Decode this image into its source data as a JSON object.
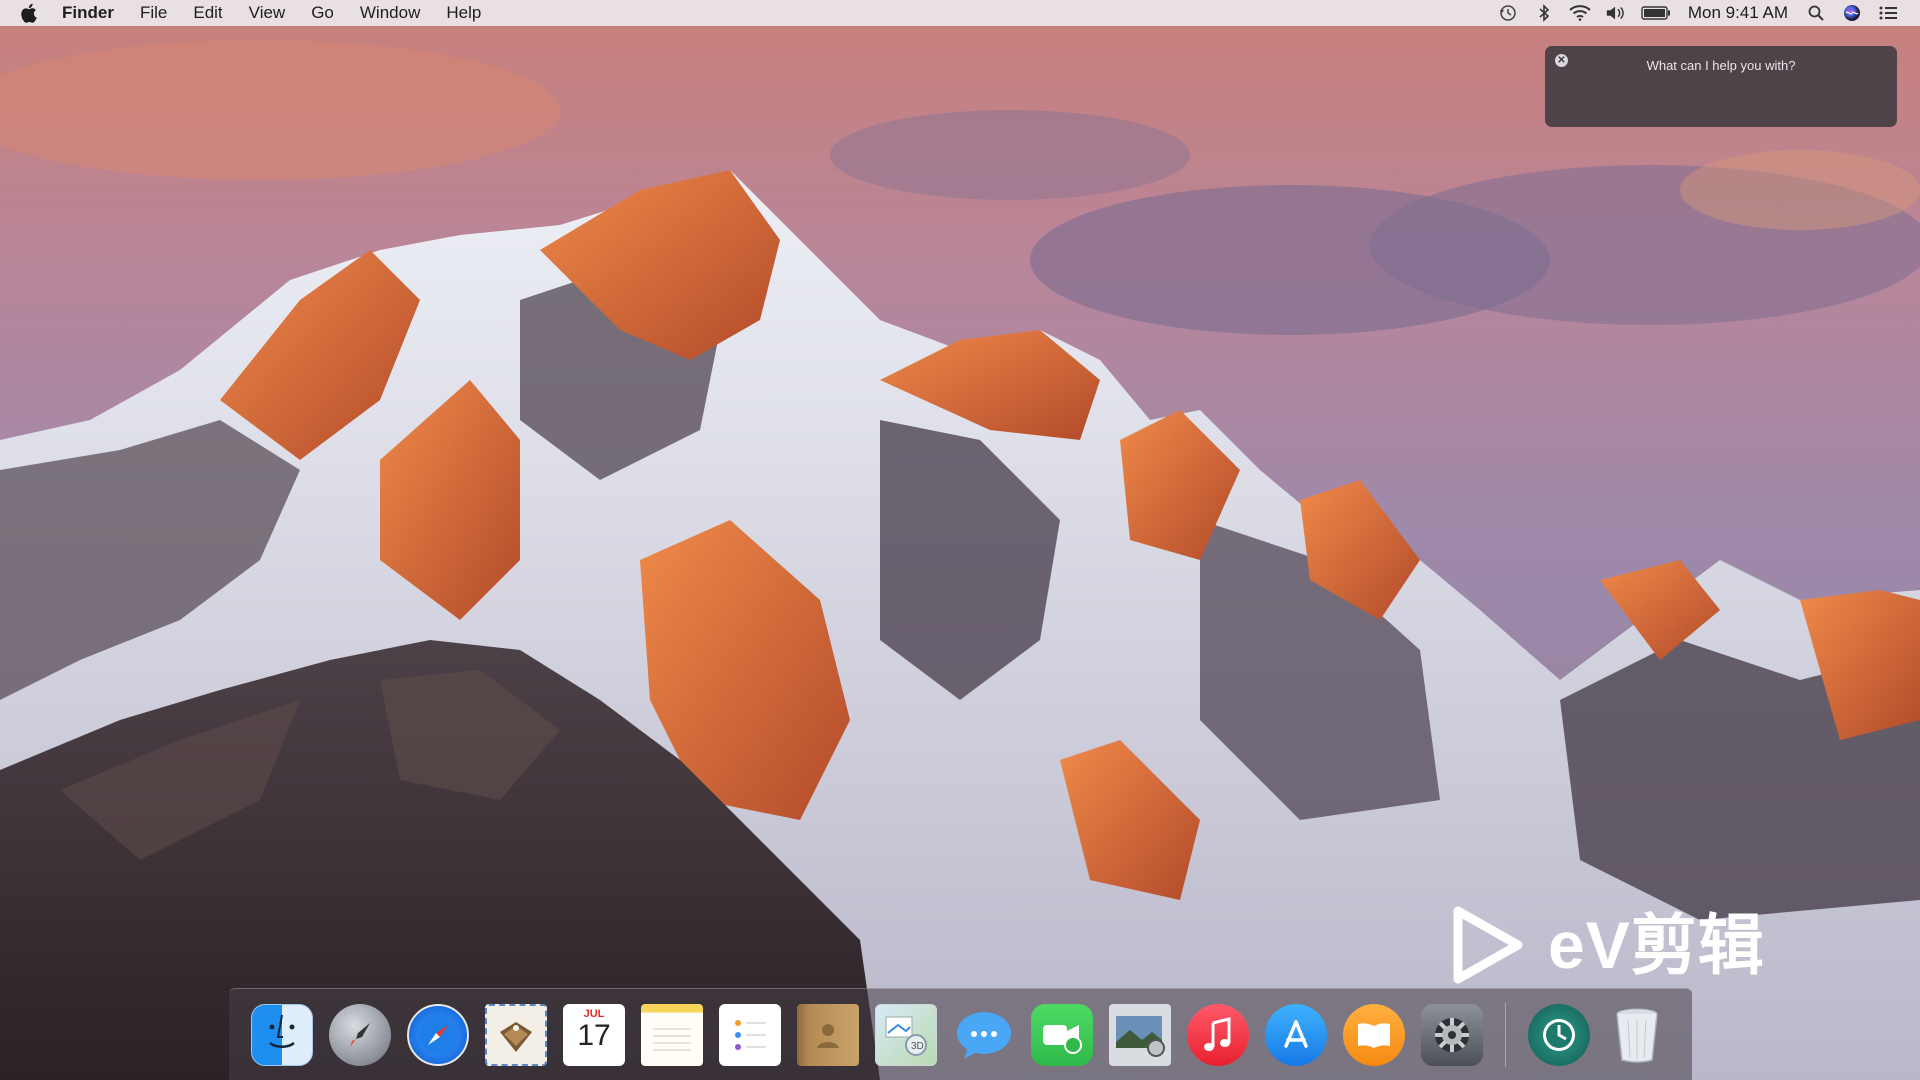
{
  "menubar": {
    "apple_icon": "apple-logo-icon",
    "app_name": "Finder",
    "menus": [
      "File",
      "Edit",
      "View",
      "Go",
      "Window",
      "Help"
    ],
    "status_icons": [
      "time-machine-icon",
      "bluetooth-icon",
      "wifi-icon",
      "volume-icon",
      "battery-icon"
    ],
    "clock": "Mon 9:41 AM",
    "right_icons": [
      "spotlight-search-icon",
      "siri-icon",
      "notification-center-icon"
    ]
  },
  "siri": {
    "prompt": "What can I help you with?",
    "close_icon": "close-icon"
  },
  "watermark": {
    "text": "eV剪辑",
    "icon": "play-icon"
  },
  "dock": {
    "apps": [
      {
        "name": "Finder",
        "icon": "finder-icon"
      },
      {
        "name": "Launchpad",
        "icon": "launchpad-icon"
      },
      {
        "name": "Safari",
        "icon": "safari-icon"
      },
      {
        "name": "Mail",
        "icon": "mail-icon"
      },
      {
        "name": "Calendar",
        "icon": "calendar-icon",
        "month": "JUL",
        "day": "17"
      },
      {
        "name": "Notes",
        "icon": "notes-icon"
      },
      {
        "name": "Reminders",
        "icon": "reminders-icon"
      },
      {
        "name": "Contacts",
        "icon": "contacts-icon"
      },
      {
        "name": "Maps",
        "icon": "maps-icon"
      },
      {
        "name": "Messages",
        "icon": "messages-icon"
      },
      {
        "name": "FaceTime",
        "icon": "facetime-icon"
      },
      {
        "name": "Photos",
        "icon": "photos-icon"
      },
      {
        "name": "iTunes",
        "icon": "itunes-icon"
      },
      {
        "name": "App Store",
        "icon": "app-store-icon"
      },
      {
        "name": "iBooks",
        "icon": "ibooks-icon"
      },
      {
        "name": "System Preferences",
        "icon": "system-preferences-icon"
      }
    ],
    "extras": [
      {
        "name": "Time Machine",
        "icon": "time-machine-dock-icon"
      },
      {
        "name": "Trash",
        "icon": "trash-icon"
      }
    ]
  },
  "colors": {
    "menubar_bg": "#ece8ea",
    "siri_bg": "#3c3a40",
    "sky_top": "#c77f7b",
    "sky_mid": "#a58aa8",
    "alpenglow": "#e0743a",
    "snow": "#e9e6ee",
    "rock_shadow": "#3c3236"
  }
}
